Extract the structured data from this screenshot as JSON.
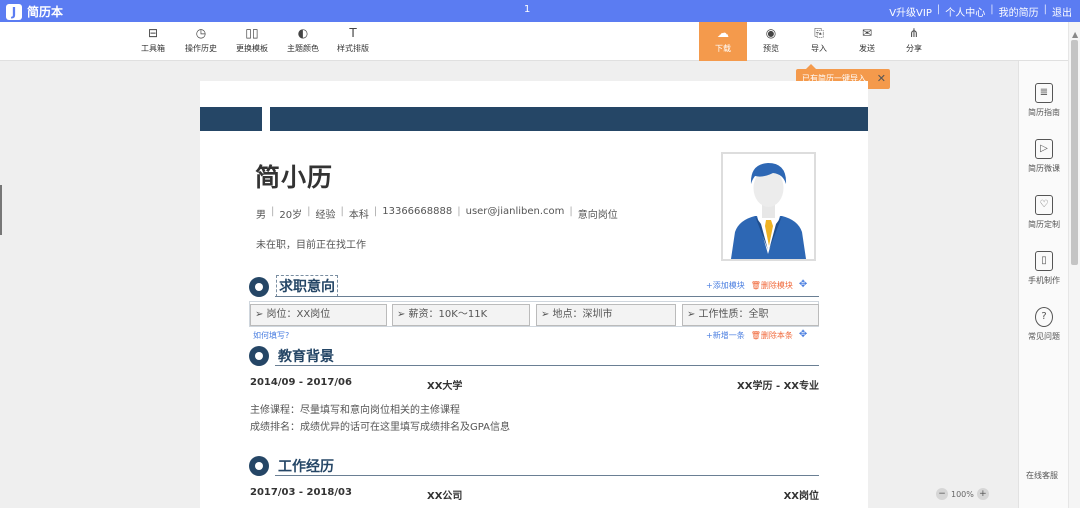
{
  "app": {
    "logo_letter": "J",
    "name": "简历本",
    "page_number": "1",
    "links": [
      "V升级VIP",
      "个人中心",
      "我的简历",
      "退出"
    ]
  },
  "toolbar": {
    "tools": [
      {
        "label": "工具箱",
        "icon": "toolbox-icon",
        "glyph": "⊟"
      },
      {
        "label": "操作历史",
        "icon": "history-icon",
        "glyph": "◷"
      },
      {
        "label": "更换模板",
        "icon": "template-icon",
        "glyph": "▯▯"
      },
      {
        "label": "主题颜色",
        "icon": "palette-icon",
        "glyph": "◐"
      },
      {
        "label": "样式排版",
        "icon": "text-style-icon",
        "glyph": "T"
      }
    ],
    "download_label": "下载",
    "actions": [
      {
        "label": "预览",
        "icon": "eye-icon",
        "glyph": "◉"
      },
      {
        "label": "导入",
        "icon": "import-icon",
        "glyph": "⎘"
      },
      {
        "label": "发送",
        "icon": "mail-icon",
        "glyph": "✉"
      },
      {
        "label": "分享",
        "icon": "share-icon",
        "glyph": "⋔"
      }
    ],
    "import_tip": "已有简历一键导入"
  },
  "right_panel": [
    {
      "label": "简历指南",
      "icon": "guide-icon",
      "glyph": "≣"
    },
    {
      "label": "简历微课",
      "icon": "video-icon",
      "glyph": "▷"
    },
    {
      "label": "简历定制",
      "icon": "custom-icon",
      "glyph": "♡"
    },
    {
      "label": "手机制作",
      "icon": "phone-icon",
      "glyph": "▯"
    },
    {
      "label": "常见问题",
      "icon": "question-icon",
      "glyph": "?"
    }
  ],
  "resume": {
    "name": "简小历",
    "basic": [
      "男",
      "20岁",
      "经验",
      "本科",
      "13366668888",
      "user@jianliben.com",
      "意向岗位"
    ],
    "status": "未在职，目前正在找工作",
    "sections": {
      "intent": {
        "title": "求职意向",
        "add_module": "+添加模块",
        "delete_module": "删除模块",
        "fields": [
          "➢ 岗位：XX岗位",
          "➢ 薪资：10K～11K",
          "➢ 地点：深圳市",
          "➢ 工作性质：全职"
        ],
        "how_to": "如何填写?",
        "add_item": "+新增一条",
        "delete_item": "删除本条"
      },
      "education": {
        "title": "教育背景",
        "period": "2014/09 - 2017/06",
        "school": "XX大学",
        "degree": "XX学历 - XX专业",
        "courses": "主修课程：尽量填写和意向岗位相关的主修课程",
        "ranking": "成绩排名：成绩优异的话可在这里填写成绩排名及GPA信息"
      },
      "work": {
        "title": "工作经历",
        "period": "2017/03 - 2018/03",
        "company": "XX公司",
        "position": "XX岗位"
      }
    }
  },
  "zoom": {
    "level": "100%",
    "minus": "−",
    "plus": "+"
  },
  "customer_service": "在线客服",
  "colors": {
    "brand": "#5b7cf2",
    "accent": "#f49a4c",
    "resume_theme": "#254666"
  }
}
